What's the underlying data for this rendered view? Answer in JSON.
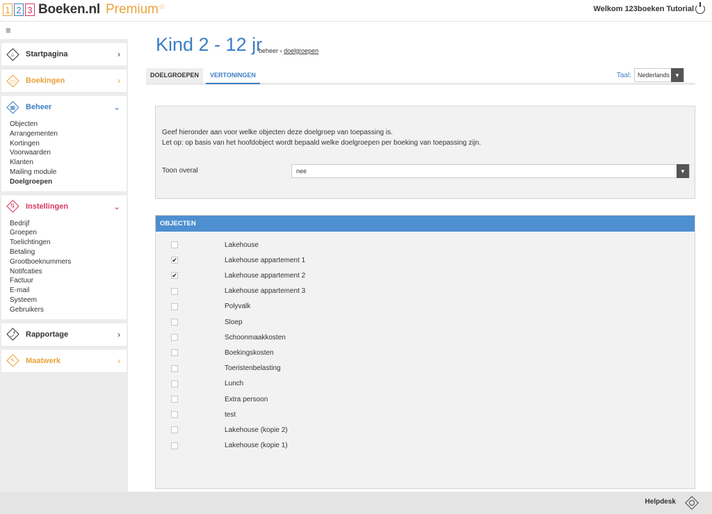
{
  "app": {
    "digits": [
      "1",
      "2",
      "3"
    ],
    "brand": "Boeken.nl",
    "edition": "Premium",
    "star": "☆",
    "welcome": "Welkom 123boeken Tutorial"
  },
  "colors": {
    "orange": "#e9a23b",
    "blue": "#3d7ec4",
    "pink": "#d9375e",
    "objecten_header": "#4e8fd0"
  },
  "sidebar": {
    "collapse_icon": "≡",
    "sections": [
      {
        "label": "Startpagina",
        "icon": "home-icon",
        "color": "#333333",
        "chevron": "›"
      },
      {
        "label": "Boekingen",
        "icon": "calendar-icon",
        "color": "#e9a23b",
        "chevron": "›"
      },
      {
        "label": "Beheer",
        "icon": "grid-icon",
        "color": "#3d7ec4",
        "chevron": "⌄",
        "items": [
          "Objecten",
          "Arrangementen",
          "Kortingen",
          "Voorwaarden",
          "Klanten",
          "Mailing module",
          "Doelgroepen"
        ],
        "active": "Doelgroepen"
      },
      {
        "label": "Instellingen",
        "icon": "settings-icon",
        "color": "#d9375e",
        "chevron": "⌄",
        "items": [
          "Bedrijf",
          "Groepen",
          "Toelichtingen",
          "Betaling",
          "Grootboeknummers",
          "Notifcaties",
          "Factuur",
          "E-mail",
          "Systeem",
          "Gebruikers"
        ]
      },
      {
        "label": "Rapportage",
        "icon": "chart-icon",
        "color": "#333333",
        "chevron": "›"
      },
      {
        "label": "Maatwerk",
        "icon": "custom-icon",
        "color": "#e9a23b",
        "chevron": "›"
      }
    ]
  },
  "main": {
    "title": "Kind 2 - 12 jr",
    "breadcrumb": {
      "root": "beheer",
      "sep": "›",
      "current": "doelgroepen"
    },
    "tabs": [
      "DOELGROEPEN",
      "VERTONINGEN"
    ],
    "active_tab": "VERTONINGEN",
    "taal": {
      "label": "Taal:",
      "value": "Nederlands"
    },
    "intro": [
      "Geef hieronder aan voor welke objecten deze doelgroep van toepassing is.",
      "Let op: op basis van het hoofdobject wordt bepaald welke doelgroepen per boeking van toepassing zijn."
    ],
    "toon_overal": {
      "label": "Toon overal",
      "value": "nee"
    },
    "objecten": {
      "header": "OBJECTEN",
      "items": [
        {
          "label": "Lakehouse",
          "checked": false
        },
        {
          "label": "Lakehouse appartement 1",
          "checked": true
        },
        {
          "label": "Lakehouse appartement 2",
          "checked": true
        },
        {
          "label": "Lakehouse appartement 3",
          "checked": false
        },
        {
          "label": "Polyvalk",
          "checked": false
        },
        {
          "label": "Sloep",
          "checked": false
        },
        {
          "label": "Schoonmaakkosten",
          "checked": false
        },
        {
          "label": "Boekingskosten",
          "checked": false
        },
        {
          "label": "Toeristenbelasting",
          "checked": false
        },
        {
          "label": "Lunch",
          "checked": false
        },
        {
          "label": "Extra persoon",
          "checked": false
        },
        {
          "label": "test",
          "checked": false
        },
        {
          "label": "Lakehouse (kopie 2)",
          "checked": false
        },
        {
          "label": "Lakehouse (kopie 1)",
          "checked": false
        }
      ]
    }
  },
  "footer": {
    "helpdesk": "Helpdesk"
  }
}
